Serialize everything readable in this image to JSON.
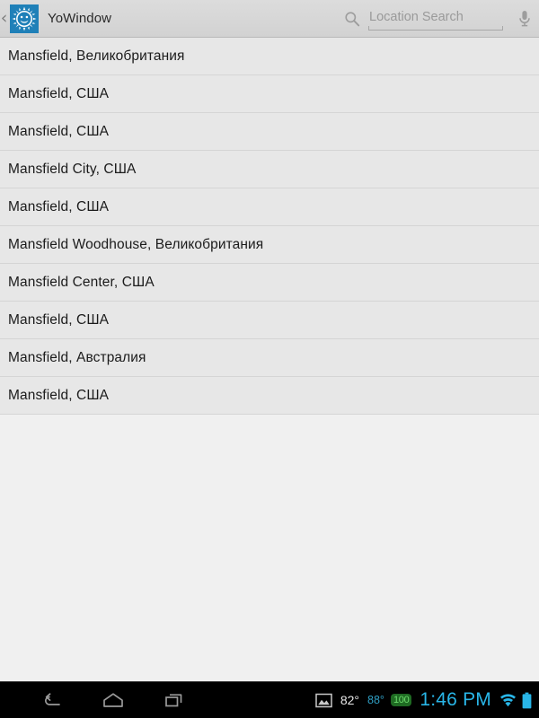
{
  "header": {
    "back_chevron": "‹",
    "app_icon_name": "yowindow-sun-smiley-icon",
    "app_icon_color": "#1f80b8",
    "title": "YoWindow",
    "search": {
      "icon": "search-icon",
      "placeholder": "Location Search",
      "value": "",
      "mic_icon": "microphone-icon"
    }
  },
  "results": [
    {
      "label": "Mansfield, Великобритания"
    },
    {
      "label": "Mansfield, США"
    },
    {
      "label": "Mansfield, США"
    },
    {
      "label": "Mansfield City, США"
    },
    {
      "label": "Mansfield, США"
    },
    {
      "label": "Mansfield Woodhouse, Великобритания"
    },
    {
      "label": "Mansfield Center, США"
    },
    {
      "label": "Mansfield, США"
    },
    {
      "label": "Mansfield, Австралия"
    },
    {
      "label": "Mansfield, США"
    }
  ],
  "navbar": {
    "back_label": "Back",
    "home_label": "Home",
    "recents_label": "Recent apps",
    "status": {
      "photo_icon": "screenshot-image-icon",
      "temperature_primary": "82°",
      "temperature_secondary": "88°",
      "badge": "100",
      "badge_bg": "#1f6b23",
      "badge_color": "#6ddc6d",
      "clock": "1:46 PM",
      "clock_color": "#29b6e8",
      "wifi_icon": "wifi-icon",
      "battery_icon": "battery-full-icon"
    }
  }
}
